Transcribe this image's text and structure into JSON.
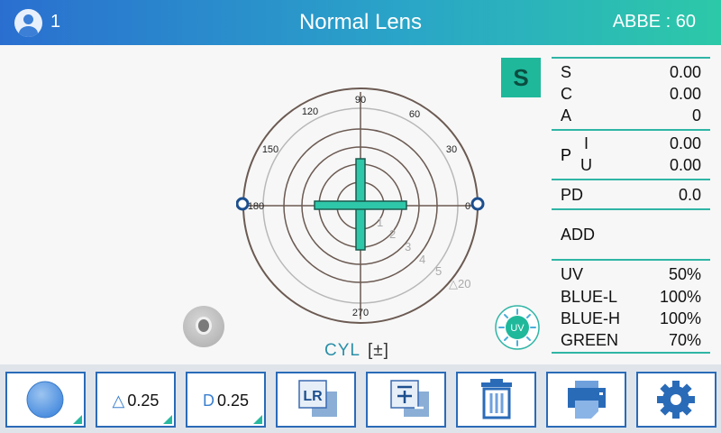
{
  "header": {
    "user_number": "1",
    "title": "Normal Lens",
    "abbe": "ABBE : 60"
  },
  "chart": {
    "angles": {
      "a90": "90",
      "a60": "60",
      "a30": "30",
      "a0": "0",
      "a120": "120",
      "a150": "150",
      "a180": "180",
      "a270": "270"
    },
    "rings": [
      "1",
      "2",
      "3",
      "4",
      "5"
    ],
    "prism_label": "△20"
  },
  "cyl": {
    "label": "CYL",
    "sign": "[±]"
  },
  "mode_badge": "S",
  "readings": {
    "S": {
      "label": "S",
      "value": "0.00"
    },
    "C": {
      "label": "C",
      "value": "0.00"
    },
    "A": {
      "label": "A",
      "value": "0"
    },
    "P_label": "P",
    "PI": {
      "label": "I",
      "value": "0.00"
    },
    "PU": {
      "label": "U",
      "value": "0.00"
    },
    "PD": {
      "label": "PD",
      "value": "0.0"
    },
    "ADD": {
      "label": "ADD",
      "value": ""
    }
  },
  "transmission": [
    {
      "label": "UV",
      "value": "50%"
    },
    {
      "label": "BLUE-L",
      "value": "100%"
    },
    {
      "label": "BLUE-H",
      "value": "100%"
    },
    {
      "label": "GREEN",
      "value": "70%"
    }
  ],
  "uv_icon_text": "UV",
  "toolbar": {
    "step_prism_symbol": "△",
    "step_prism_value": "0.25",
    "step_diopter_symbol": "D",
    "step_diopter_value": "0.25",
    "lr_text": "LR"
  },
  "colors": {
    "accent_teal": "#27b8a0",
    "accent_blue": "#2a6bb8",
    "cross": "#2ec7a9"
  }
}
